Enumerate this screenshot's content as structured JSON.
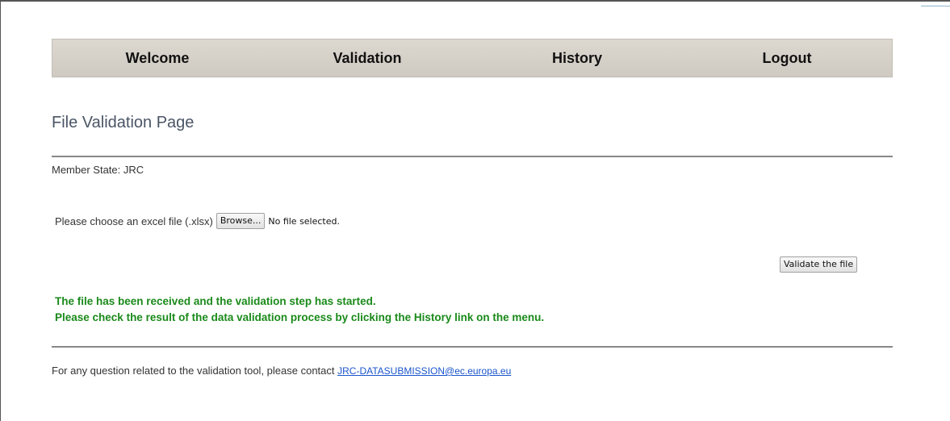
{
  "nav": {
    "items": [
      {
        "label": "Welcome"
      },
      {
        "label": "Validation"
      },
      {
        "label": "History"
      },
      {
        "label": "Logout"
      }
    ]
  },
  "page": {
    "title": "File Validation Page",
    "member_state": "Member State: JRC"
  },
  "upload": {
    "prompt": "Please choose an excel file (.xlsx)",
    "browse_label": "Browse...",
    "status": "No file selected.",
    "validate_label": "Validate the file"
  },
  "messages": {
    "line1": "The file has been received and the validation step has started.",
    "line2": "Please check the result of the data validation process by clicking the History link on the menu."
  },
  "footer": {
    "contact_text": "For any question related to the validation tool, please contact ",
    "contact_email": "JRC-DATASUBMISSION@ec.europa.eu"
  },
  "colors": {
    "success": "#1a8a1a",
    "link": "#1a55cc",
    "nav_bg": "#d6d2ca"
  }
}
